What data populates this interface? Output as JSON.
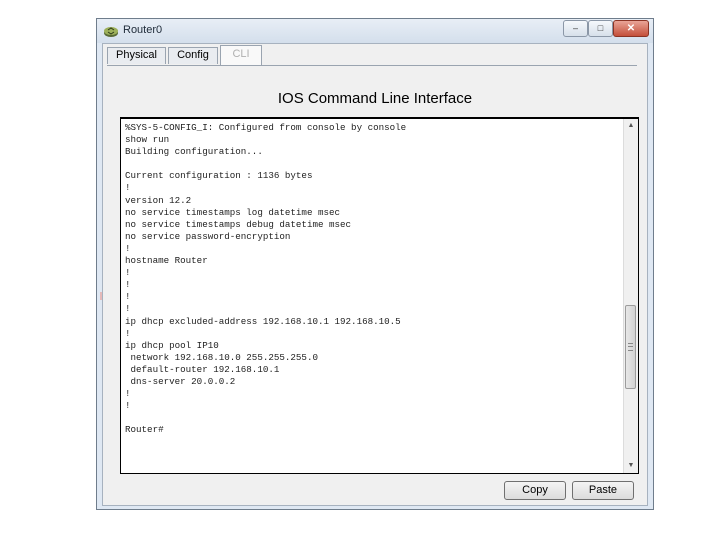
{
  "window": {
    "title": "Router0",
    "controls": {
      "minimize": "–",
      "maximize": "□",
      "close": "✕"
    }
  },
  "tabs": [
    {
      "label": "Physical",
      "active": false
    },
    {
      "label": "Config",
      "active": false
    },
    {
      "label": "CLI",
      "active": true
    }
  ],
  "heading": "IOS Command Line Interface",
  "console": {
    "lines": [
      "%SYS-5-CONFIG_I: Configured from console by console",
      "show run",
      "Building configuration...",
      "",
      "Current configuration : 1136 bytes",
      "!",
      "version 12.2",
      "no service timestamps log datetime msec",
      "no service timestamps debug datetime msec",
      "no service password-encryption",
      "!",
      "hostname Router",
      "!",
      "!",
      "!",
      "!",
      "ip dhcp excluded-address 192.168.10.1 192.168.10.5",
      "!",
      "ip dhcp pool IP10",
      " network 192.168.10.0 255.255.255.0",
      " default-router 192.168.10.1",
      " dns-server 20.0.0.2",
      "!",
      "!",
      "",
      "Router#"
    ],
    "scrollbar": {
      "up": "▲",
      "down": "▼"
    }
  },
  "buttons": {
    "copy": "Copy",
    "paste": "Paste"
  },
  "colors": {
    "window_frame": "#dfe8f3",
    "close_button": "#c44f3a",
    "console_bg": "#ffffff"
  },
  "icons": {
    "app": "router-icon"
  }
}
